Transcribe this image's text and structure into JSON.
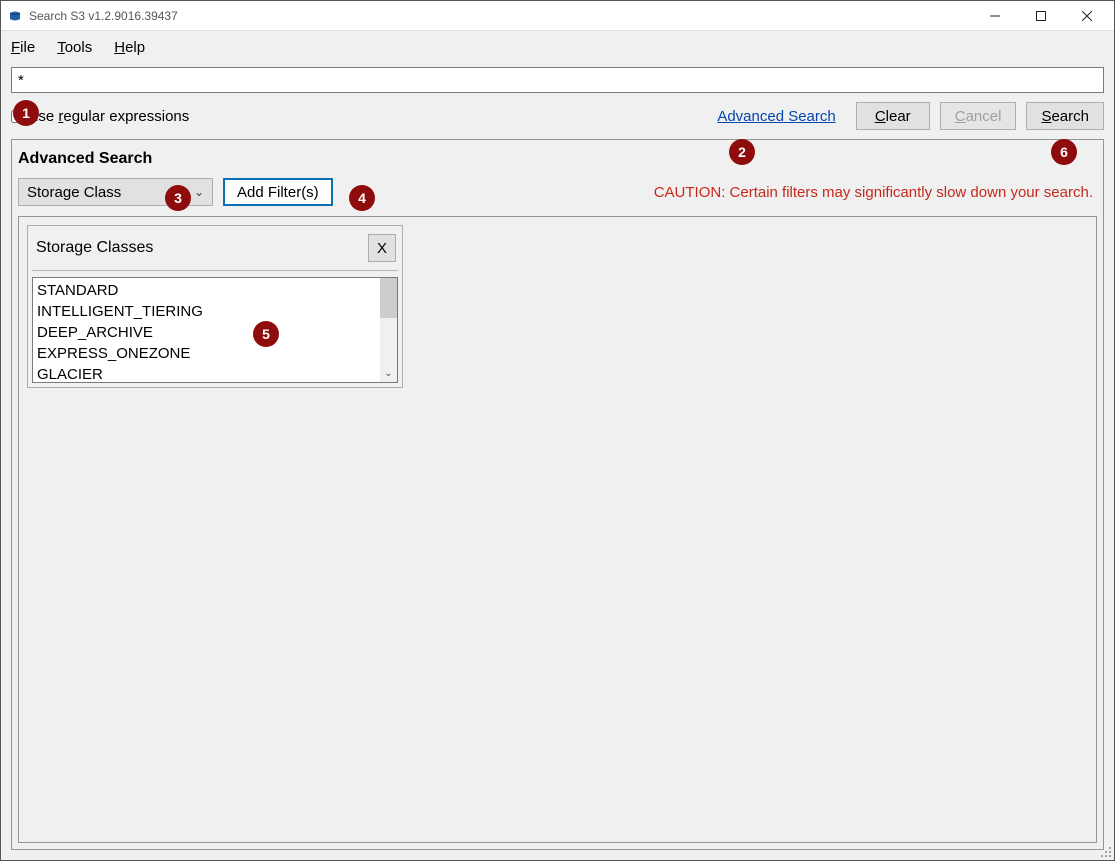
{
  "window": {
    "title": "Search S3 v1.2.9016.39437"
  },
  "menubar": {
    "file": "File",
    "file_ul": "F",
    "tools": "Tools",
    "tools_ul": "T",
    "help": "Help",
    "help_ul": "H"
  },
  "search": {
    "value": "*"
  },
  "options": {
    "regex_label_pre": "use ",
    "regex_label_ul": "r",
    "regex_label_post": "egular expressions",
    "advanced_link": "Advanced Search",
    "clear_pre": "",
    "clear_ul": "C",
    "clear_post": "lear",
    "cancel_pre": "",
    "cancel_ul": "C",
    "cancel_post": "ancel",
    "search_pre": "",
    "search_ul": "S",
    "search_post": "earch"
  },
  "advanced": {
    "title": "Advanced Search",
    "filter_select": "Storage Class",
    "add_filter": "Add Filter(s)",
    "caution": "CAUTION: Certain filters may significantly slow down your search."
  },
  "filter_card": {
    "title": "Storage Classes",
    "close": "X",
    "items": [
      "STANDARD",
      "INTELLIGENT_TIERING",
      "DEEP_ARCHIVE",
      "EXPRESS_ONEZONE",
      "GLACIER"
    ]
  },
  "badges": {
    "b1": "1",
    "b2": "2",
    "b3": "3",
    "b4": "4",
    "b5": "5",
    "b6": "6"
  }
}
